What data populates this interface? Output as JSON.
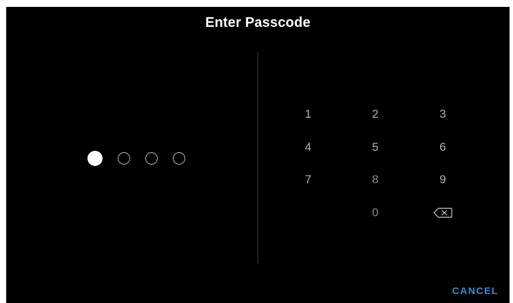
{
  "title": "Enter Passcode",
  "passcode": {
    "entered_count": 1,
    "length": 4
  },
  "keypad": {
    "keys": [
      "1",
      "2",
      "3",
      "4",
      "5",
      "6",
      "7",
      "8",
      "9",
      "",
      "0",
      "backspace-icon"
    ]
  },
  "cancel_label": "CANCEL",
  "colors": {
    "background": "#000000",
    "accent": "#2f8fdc",
    "text": "#ffffff"
  }
}
